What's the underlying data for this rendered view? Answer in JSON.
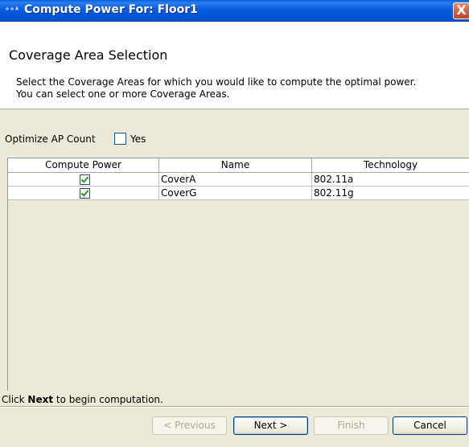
{
  "window": {
    "title": "Compute Power For: Floor1",
    "app_icon": "app-icon",
    "close_label": "X"
  },
  "header": {
    "title": "Coverage Area Selection",
    "description": "Select the Coverage Areas for which you would like to compute the optimal power. You can select one or more Coverage Areas."
  },
  "optimize": {
    "label": "Optimize AP Count",
    "checked": false,
    "option_label": "Yes"
  },
  "table": {
    "columns": [
      "Compute Power",
      "Name",
      "Technology"
    ],
    "rows": [
      {
        "compute_power": true,
        "name": "CoverA",
        "technology": "802.11a"
      },
      {
        "compute_power": true,
        "name": "CoverG",
        "technology": "802.11g"
      }
    ]
  },
  "status": {
    "prefix": "Click ",
    "bold": "Next",
    "suffix": " to begin computation."
  },
  "buttons": {
    "previous": "< Previous",
    "next": "Next >",
    "finish": "Finish",
    "cancel": "Cancel"
  }
}
